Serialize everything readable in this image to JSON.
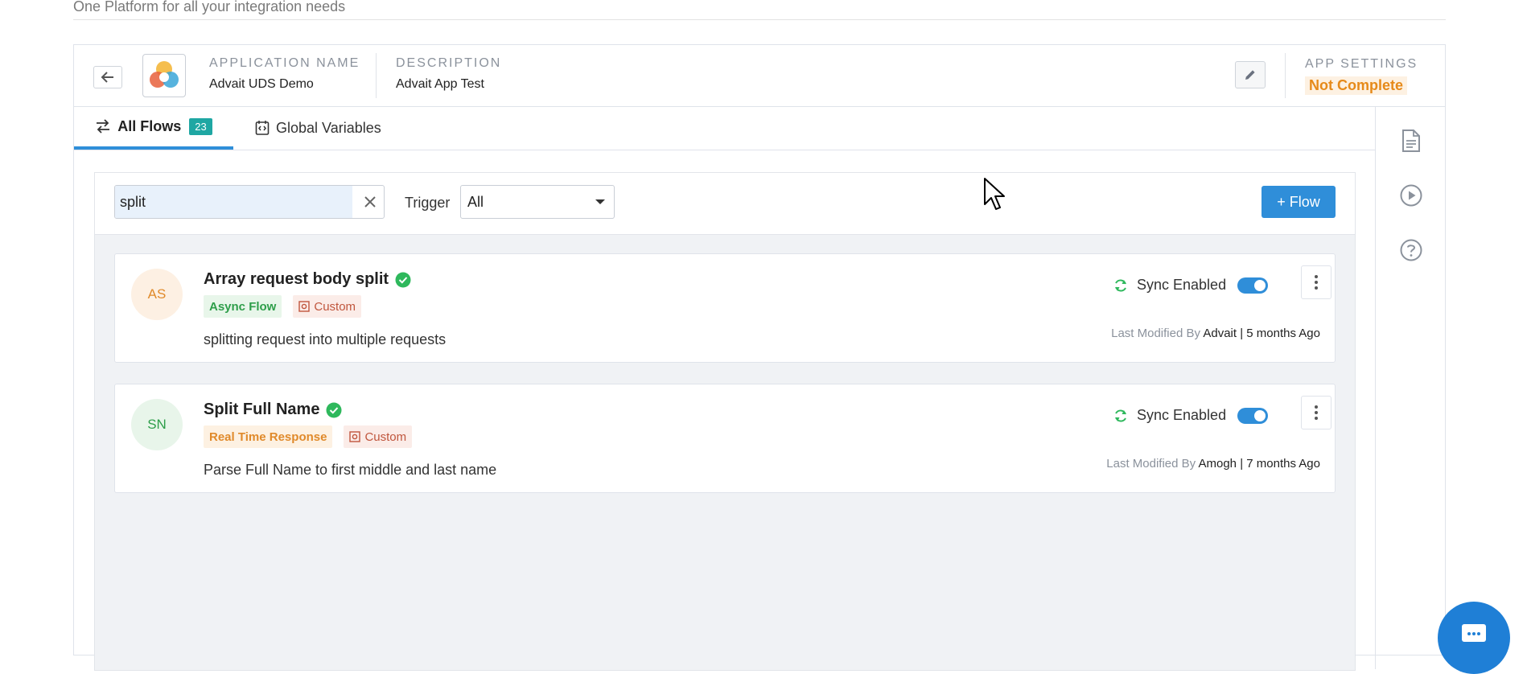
{
  "tagline": "One Platform for all your integration needs",
  "app": {
    "name_label": "APPLICATION NAME",
    "name": "Advait UDS Demo",
    "description_label": "DESCRIPTION",
    "description": "Advait App Test",
    "settings_label": "APP SETTINGS",
    "settings_status": "Not Complete"
  },
  "tabs": {
    "all_flows": "All Flows",
    "all_flows_count": "23",
    "global_variables": "Global Variables"
  },
  "filters": {
    "search_value": "split",
    "trigger_label": "Trigger",
    "trigger_value": "All",
    "add_flow_label": "+ Flow"
  },
  "flows": [
    {
      "initials": "AS",
      "title": "Array request body split",
      "type_chip": "Async Flow",
      "category_chip": "Custom",
      "description": "splitting request into multiple requests",
      "sync_label": "Sync Enabled",
      "modified_prefix": "Last Modified By",
      "modified_detail": "Advait | 5 months Ago"
    },
    {
      "initials": "SN",
      "title": "Split Full Name",
      "type_chip": "Real Time Response",
      "category_chip": "Custom",
      "description": "Parse Full Name to first middle and last name",
      "sync_label": "Sync Enabled",
      "modified_prefix": "Last Modified By",
      "modified_detail": "Amogh | 7 months Ago"
    }
  ],
  "colors": {
    "accent": "#2f8ed9",
    "badge_teal": "#1fa7a3",
    "status_orange": "#e68a1a",
    "success_green": "#2e9e4a"
  },
  "icons": {
    "back": "arrow-left-icon",
    "logo": "app-logo-icon",
    "edit": "pencil-icon",
    "flows": "swap-arrows-icon",
    "variables": "code-variable-icon",
    "clear": "close-icon",
    "dropdown": "caret-down-icon",
    "verified": "check-circle-icon",
    "sync": "sync-icon",
    "more": "kebab-menu-icon",
    "rail": [
      "document-icon",
      "play-circle-icon",
      "help-circle-icon"
    ],
    "chat": "chat-icon"
  }
}
